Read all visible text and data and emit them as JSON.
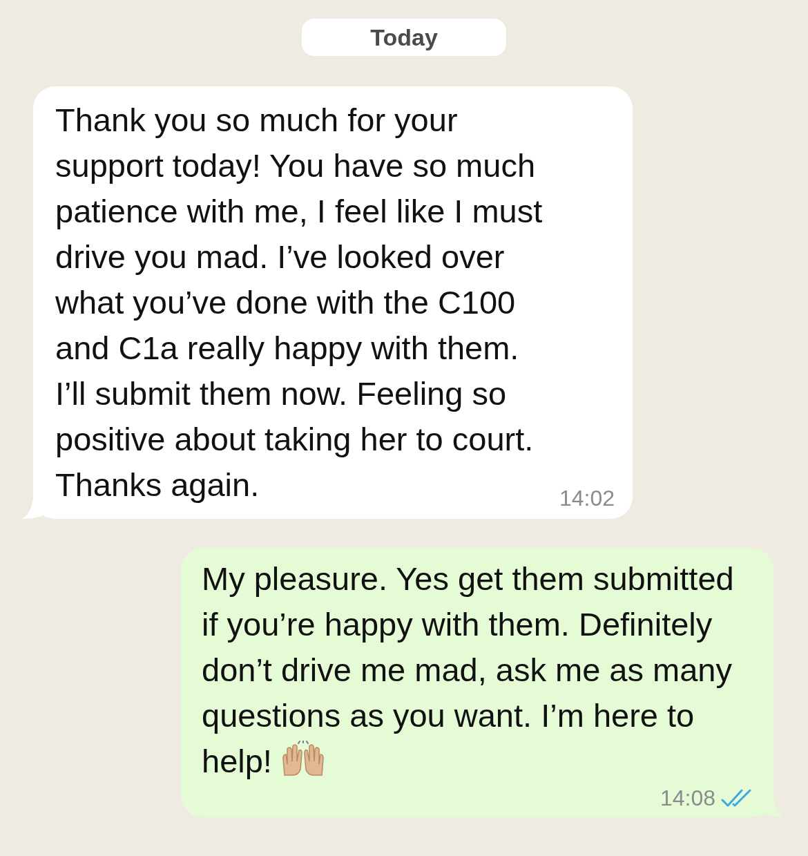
{
  "date_divider": "Today",
  "messages": [
    {
      "kind": "incoming",
      "text": "Thank you so much for your support today! You have so much patience with me, I feel like I must drive you mad. I’ve looked over what you’ve done with the C100 and C1a really happy with them. I’ll submit them now. Feeling so positive about taking her to court. Thanks again.",
      "time": "14:02"
    },
    {
      "kind": "outgoing",
      "text": "My pleasure. Yes get them submitted if you’re happy with them. Definitely don’t drive me mad, ask me as many questions as you want. I’m here to help!",
      "emoji": true,
      "time": "14:08",
      "read": true
    }
  ]
}
